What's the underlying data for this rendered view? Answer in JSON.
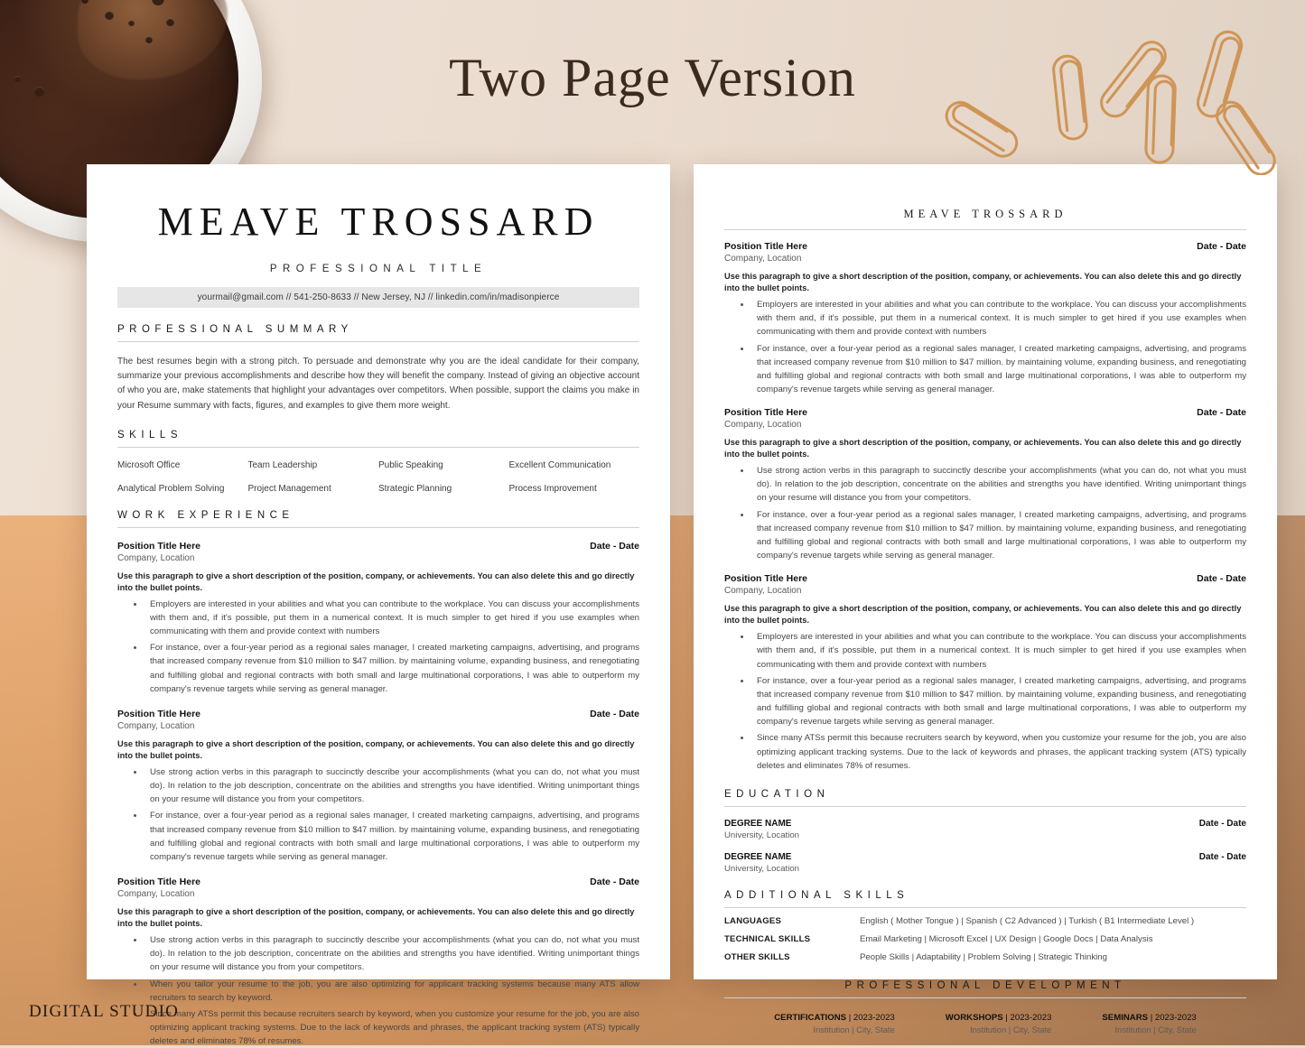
{
  "banner": {
    "title": "Two Page Version"
  },
  "watermark": {
    "text": "DIGITAL STUDIO"
  },
  "resume": {
    "name": "MEAVE TROSSARD",
    "professional_title": "PROFESSIONAL TITLE",
    "contact": "yourmail@gmail.com // 541-250-8633 // New Jersey, NJ // linkedin.com/in/madisonpierce",
    "sections": {
      "summary_heading": "PROFESSIONAL SUMMARY",
      "skills_heading": "SKILLS",
      "work_heading": "WORK EXPERIENCE",
      "education_heading": "EDUCATION",
      "additional_skills_heading": "ADDITIONAL SKILLS",
      "professional_development_heading": "PROFESSIONAL DEVELOPMENT"
    },
    "summary_text": "The best resumes begin with a strong pitch. To persuade and demonstrate why you are the ideal candidate for their company, summarize your previous accomplishments and describe how they will benefit the company. Instead of giving an objective account of who you are, make statements that highlight your advantages over competitors. When possible, support the claims you make in your Resume summary with facts, figures, and examples to give them more weight.",
    "skills": [
      "Microsoft Office",
      "Team Leadership",
      "Public Speaking",
      "Excellent Communication",
      "Analytical Problem Solving",
      "Project Management",
      "Strategic Planning",
      "Process Improvement"
    ],
    "entry_desc": "Use this paragraph to give a short description of the position, company, or achievements. You can also delete this and go directly into the bullet points.",
    "bullet_library": {
      "employers": "Employers are interested in your abilities and what you can contribute to the workplace. You can discuss your accomplishments with them and, if it's possible, put them in a numerical context. It is much simpler to get hired if you use examples when communicating with them and provide context with numbers",
      "instance": "For instance, over a four-year period as a regional sales manager, I created marketing campaigns, advertising, and programs that increased company revenue from $10 million to $47 million. by maintaining volume, expanding business, and renegotiating and fulfilling global and regional contracts with both small and large multinational corporations, I was able to outperform my company's revenue targets while serving as general manager.",
      "action_verbs": "Use strong action verbs in this paragraph to succinctly describe your accomplishments        (what you can do, not what you must do). In relation to the job description, concentrate on the abilities and strengths you have identified. Writing unimportant things on your resume will distance you from your competitors.",
      "tailor": "When you tailor your resume to the job, you are also optimizing for applicant tracking systems because many ATS allow recruiters to search by keyword.",
      "ats": "Since many ATSs permit this because recruiters search by keyword, when you customize your resume for the job, you are also optimizing applicant tracking systems. Due to the lack of keywords and phrases, the applicant tracking system (ATS) typically deletes and eliminates 78% of resumes."
    },
    "page1_entries": [
      {
        "title": "Position Title Here",
        "date": "Date - Date",
        "company": "Company, Location",
        "bullets": [
          "employers",
          "instance"
        ]
      },
      {
        "title": "Position Title Here",
        "date": "Date - Date",
        "company": "Company, Location",
        "bullets": [
          "action_verbs",
          "instance"
        ]
      },
      {
        "title": "Position Title Here",
        "date": "Date - Date",
        "company": "Company, Location",
        "bullets": [
          "action_verbs",
          "tailor",
          "ats"
        ]
      }
    ],
    "page2_entries": [
      {
        "title": "Position Title Here",
        "date": "Date - Date",
        "company": "Company, Location",
        "bullets": [
          "employers",
          "instance"
        ]
      },
      {
        "title": "Position Title Here",
        "date": "Date - Date",
        "company": "Company, Location",
        "bullets": [
          "action_verbs",
          "instance"
        ]
      },
      {
        "title": "Position Title Here",
        "date": "Date - Date",
        "company": "Company, Location",
        "bullets": [
          "employers",
          "instance",
          "ats"
        ]
      }
    ],
    "education": [
      {
        "degree": "DEGREE NAME",
        "date": "Date - Date",
        "school": "University, Location"
      },
      {
        "degree": "DEGREE NAME",
        "date": "Date - Date",
        "school": "University, Location"
      }
    ],
    "additional_skills": [
      {
        "label": "LANGUAGES",
        "value": "English ( Mother Tongue )  |  Spanish ( C2 Advanced )  |  Turkish ( B1 Intermediate Level )"
      },
      {
        "label": "TECHNICAL SKILLS",
        "value": "Email Marketing  |  Microsoft Excel  |  UX Design  |  Google Docs  |  Data Analysis"
      },
      {
        "label": "OTHER SKILLS",
        "value": "People Skills  |  Adaptability  |  Problem Solving  |  Strategic Thinking"
      }
    ],
    "professional_development": [
      {
        "name": "CERTIFICATIONS",
        "years": "2023-2023",
        "sub": "Institution | City, State"
      },
      {
        "name": "WORKSHOPS",
        "years": "2023-2023",
        "sub": "Institution | City, State"
      },
      {
        "name": "SEMINARS",
        "years": "2023-2023",
        "sub": "Institution | City, State"
      }
    ]
  },
  "colors": {
    "background_top": "#eadccf",
    "background_bottom": "#e8a368",
    "page": "#ffffff",
    "contact_bar": "#e6e6e6",
    "rule": "#cfcfcf",
    "banner_text": "#3b2a20"
  }
}
